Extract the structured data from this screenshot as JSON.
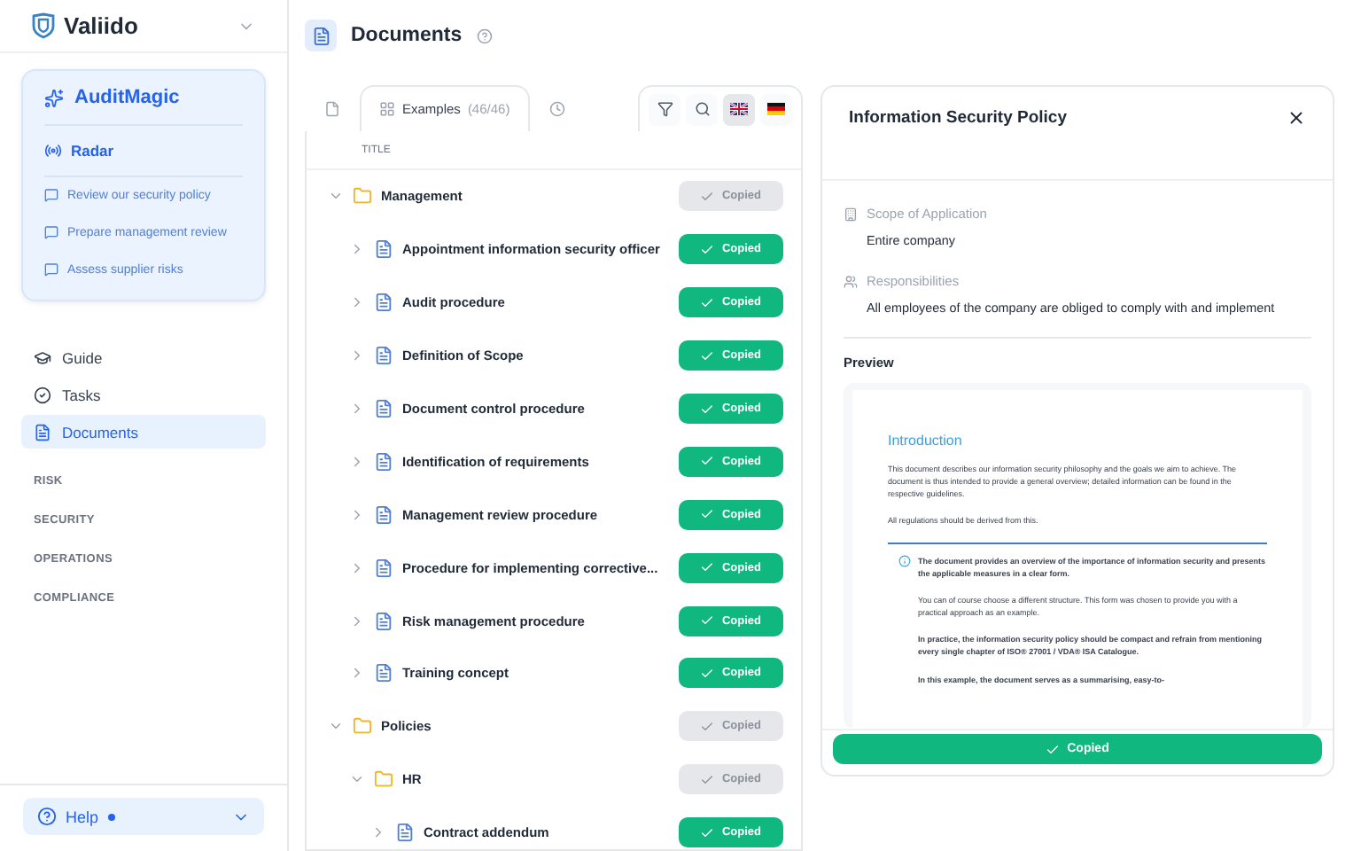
{
  "brand": {
    "name": "Valiido"
  },
  "assistant": {
    "title": "AuditMagic",
    "section": "Radar",
    "prompts": [
      "Review our security policy",
      "Prepare management review",
      "Assess supplier risks"
    ]
  },
  "nav": [
    {
      "label": "Guide",
      "kind": "guide",
      "selected": false
    },
    {
      "label": "Tasks",
      "kind": "tasks",
      "selected": false
    },
    {
      "label": "Documents",
      "kind": "documents",
      "selected": true
    }
  ],
  "sections": [
    "RISK",
    "SECURITY",
    "OPERATIONS",
    "COMPLIANCE"
  ],
  "help": {
    "label": "Help",
    "notification": true
  },
  "page": {
    "title": "Documents"
  },
  "tabs": [
    {
      "kind": "files",
      "selected": false
    },
    {
      "kind": "examples",
      "label": "Examples",
      "count": "(46/46)",
      "selected": true
    },
    {
      "kind": "history",
      "selected": false
    }
  ],
  "languages": [
    {
      "kind": "en",
      "selected": true
    },
    {
      "kind": "de",
      "selected": false
    }
  ],
  "table": {
    "column": "TITLE",
    "rows": [
      {
        "kind": "folder",
        "title": "Management",
        "expanded": true,
        "action": "Copied",
        "disabled": true,
        "children": [
          {
            "kind": "document",
            "title": "Appointment information security officer",
            "expanded": false,
            "action": "Copied",
            "disabled": false
          },
          {
            "kind": "document",
            "title": "Audit procedure",
            "expanded": false,
            "action": "Copied",
            "disabled": false
          },
          {
            "kind": "document",
            "title": "Definition of Scope",
            "expanded": false,
            "action": "Copied",
            "disabled": false
          },
          {
            "kind": "document",
            "title": "Document control procedure",
            "expanded": false,
            "action": "Copied",
            "disabled": false
          },
          {
            "kind": "document",
            "title": "Identification of requirements",
            "expanded": false,
            "action": "Copied",
            "disabled": false
          },
          {
            "kind": "document",
            "title": "Management review procedure",
            "expanded": false,
            "action": "Copied",
            "disabled": false
          },
          {
            "kind": "document",
            "title": "Procedure for implementing corrective...",
            "expanded": false,
            "action": "Copied",
            "disabled": false
          },
          {
            "kind": "document",
            "title": "Risk management procedure",
            "expanded": false,
            "action": "Copied",
            "disabled": false
          },
          {
            "kind": "document",
            "title": "Training concept",
            "expanded": false,
            "action": "Copied",
            "disabled": false
          }
        ]
      },
      {
        "kind": "folder",
        "title": "Policies",
        "expanded": true,
        "action": "Copied",
        "disabled": true,
        "children": [
          {
            "kind": "folder",
            "title": "HR",
            "expanded": true,
            "action": "Copied",
            "disabled": true,
            "children": [
              {
                "kind": "document",
                "title": "Contract addendum",
                "expanded": false,
                "action": "Copied",
                "disabled": false
              }
            ]
          }
        ]
      }
    ]
  },
  "detail": {
    "title": "Information Security Policy",
    "fields": [
      {
        "kind": "scope",
        "label": "Scope of Application",
        "value": "Entire company"
      },
      {
        "kind": "people",
        "label": "Responsibilities",
        "value": "All employees of the company are obliged to comply with and implement"
      }
    ],
    "preview_label": "Preview",
    "preview": {
      "heading": "Introduction",
      "paragraphs": [
        "This document describes our information security philosophy and the goals we aim to achieve. The document is thus intended to provide a general overview; detailed information can be found in the respective guidelines.",
        "All regulations should be derived from this."
      ],
      "note": [
        {
          "kind": "bold",
          "text": "The document provides an overview of the importance of information security and presents the applicable measures in a clear form."
        },
        {
          "kind": "plain",
          "text": "You can of course choose a different structure. This form was chosen to provide you with a practical approach as an example."
        },
        {
          "kind": "bold",
          "text": "In practice, the information security policy should be compact and refrain from mentioning every single chapter of ISO® 27001 / VDA® ISA Catalogue."
        },
        {
          "kind": "bold",
          "text": "In this example, the document serves as a summarising, easy-to-"
        }
      ]
    },
    "action": "Copied"
  }
}
